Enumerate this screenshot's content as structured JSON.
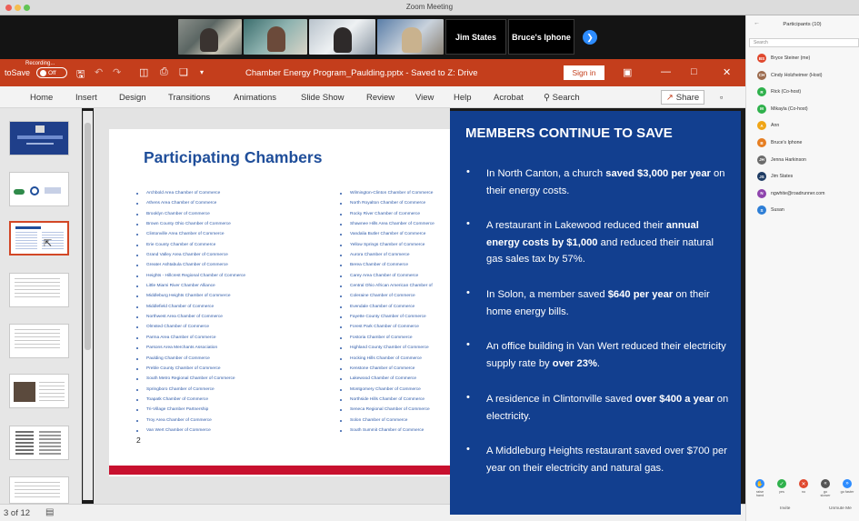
{
  "zoom": {
    "window_title": "Zoom Meeting",
    "gallery": {
      "name_tiles": [
        "Jim States",
        "Bruce's Iphone"
      ]
    },
    "participants": {
      "title": "Participants (10)",
      "search_placeholder": "Search",
      "list": [
        {
          "initials": "BS",
          "name": "Bryce Steiner (me)",
          "color": "#e0482e"
        },
        {
          "initials": "CH",
          "name": "Cindy Holzheimer (Host)",
          "color": "#9c6b4e"
        },
        {
          "initials": "R",
          "name": "Rick (Co-host)",
          "color": "#2fb14c"
        },
        {
          "initials": "M",
          "name": "Mikayla (Co-host)",
          "color": "#2fb14c"
        },
        {
          "initials": "A",
          "name": "Ann",
          "color": "#f0a516"
        },
        {
          "initials": "B",
          "name": "Bruce's Iphone",
          "color": "#e67e22"
        },
        {
          "initials": "JH",
          "name": "Jenna Harkinson",
          "color": "#6b6b6b"
        },
        {
          "initials": "JS",
          "name": "Jim States",
          "color": "#1e3b63"
        },
        {
          "initials": "N",
          "name": "ngwhite@roadrunner.com",
          "color": "#8e44ad"
        },
        {
          "initials": "S",
          "name": "Susan",
          "color": "#2d7ed6"
        }
      ],
      "buttons": [
        "raise hand",
        "yes",
        "no",
        "go slower",
        "go faster"
      ],
      "footer": {
        "invite": "Invite",
        "unmute": "Unmute Me"
      }
    }
  },
  "powerpoint": {
    "autosave_label": "toSave",
    "recording_label": "Recording...",
    "autosave_state": "Off",
    "file_title": "Chamber Energy Program_Paulding.pptx  -  Saved to Z: Drive",
    "sign_in": "Sign in",
    "ribbon_tabs": [
      "Home",
      "Insert",
      "Design",
      "Transitions",
      "Animations",
      "Slide Show",
      "Review",
      "View",
      "Help",
      "Acrobat"
    ],
    "search_label": "Search",
    "share_label": "Share",
    "status_slide": "3 of 12"
  },
  "slide": {
    "title": "Participating Chambers",
    "number": "2",
    "col1": [
      "Archbold Area Chamber of Commerce",
      "Athens Area Chamber of Commerce",
      "Brooklyn Chamber of Commerce",
      "Brown County Ohio Chamber of Commerce",
      "Clintonville Area Chamber of Commerce",
      "Erie County Chamber of Commerce",
      "Grand Valley Area Chamber of Commerce",
      "Greater Ashtabula Chamber of Commerce",
      "Heights - Hillcrest Regional Chamber of Commerce",
      "Little Miami River Chamber Alliance",
      "Middleburg Heights Chamber of Commerce",
      "Middlefield Chamber of Commerce",
      "Northwest Area Chamber of Commerce",
      "Olmsted Chamber of Commerce",
      "Parma Area Chamber of Commerce",
      "Parsons Area Merchants Association",
      "Paulding Chamber of Commerce",
      "Preble County Chamber of Commerce",
      "South Metro Regional Chamber of Commerce",
      "Springboro Chamber of Commerce",
      "Toapatk Chamber of Commerce",
      "Tri-Village Chamber Partnership",
      "Troy Area Chamber of Commerce",
      "Van Wert Chamber of Commerce"
    ],
    "col2": [
      "Wilmington-Clinton Chamber of Commerce",
      "North Royalton Chamber of Commerce",
      "Rocky River Chamber of Commerce",
      "Shawnee Hills Area Chamber of Commerce",
      "Vandalia Butler Chamber of Commerce",
      "Yellow Springs Chamber of Commerce",
      "Aurora Chamber of Commerce",
      "Berea Chamber of Commerce",
      "Carey Area Chamber of Commerce",
      "Central Ohio African American Chamber of",
      "Coleraine Chamber of Commerce",
      "Evendale Chamber of Commerce",
      "Fayette County Chamber of Commerce",
      "Forest Park Chamber of Commerce",
      "Fostoria Chamber of Commerce",
      "Highland County Chamber of Commerce",
      "Hocking Hills Chamber of Commerce",
      "Kenstone Chamber of Commerce",
      "Lakewood Chamber of Commerce",
      "Montgomery Chamber of Commerce",
      "Northside Hills Chamber of Commerce",
      "Seneca Regional Chamber of Commerce",
      "Solon Chamber of Commerce",
      "South Summit Chamber of Commerce"
    ]
  },
  "panel": {
    "heading": "MEMBERS CONTINUE TO SAVE",
    "bullets": [
      {
        "pre": "In North Canton, a church ",
        "bold": "saved $3,000 per year",
        "post": " on their energy costs."
      },
      {
        "pre": "A restaurant in Lakewood reduced their ",
        "bold": "annual energy costs by $1,000",
        "post": " and reduced their natural gas sales tax by 57%."
      },
      {
        "pre": "In Solon, a member saved ",
        "bold": "$640 per year",
        "post": " on their home energy bills."
      },
      {
        "pre": "An office building in Van Wert reduced their electricity supply rate by ",
        "bold": "over 23%",
        "post": "."
      },
      {
        "pre": "A residence in Clintonville saved ",
        "bold": "over $400 a year",
        "post": " on electricity."
      },
      {
        "pre": "A Middleburg Heights restaurant saved over $700 per year on their electricity and natural gas.",
        "bold": "",
        "post": ""
      }
    ]
  },
  "colors": {
    "ppt_red": "#c43e1c",
    "panel_blue": "#123f8f",
    "slide_title_blue": "#1f4e9a",
    "zoom_blue": "#2d8cff"
  }
}
